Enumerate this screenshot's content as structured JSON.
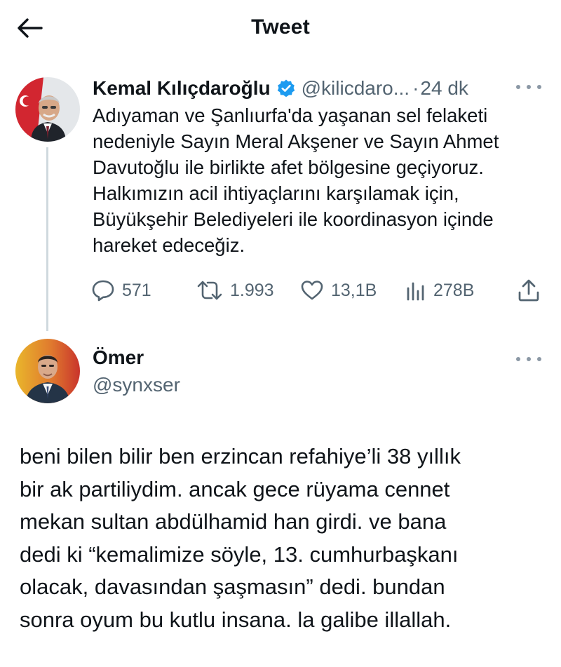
{
  "header": {
    "title": "Tweet",
    "back_icon": "arrow-left-icon"
  },
  "tweet": {
    "author_name": "Kemal Kılıçdaroğlu",
    "verified_icon": "verified-badge-icon",
    "verified_color": "#1d9bf0",
    "handle": "@kilicdaro...",
    "separator": "·",
    "time": "24 dk",
    "text_lines": [
      "Adıyaman ve Şanlıurfa'da yaşanan sel felaketi",
      "nedeniyle Sayın Meral Akşener ve Sayın Ahmet",
      "Davutoğlu ile birlikte afet bölgesine geçiyoruz.",
      "Halkımızın acil ihtiyaçlarını karşılamak için,",
      "Büyükşehir Belediyeleri ile koordinasyon içinde",
      "hareket edeceğiz."
    ],
    "actions": {
      "reply": {
        "icon": "reply-icon",
        "count": "571"
      },
      "retweet": {
        "icon": "retweet-icon",
        "count": "1.993"
      },
      "like": {
        "icon": "heart-icon",
        "count": "13,1B"
      },
      "views": {
        "icon": "views-chart-icon",
        "count": "278B"
      },
      "share": {
        "icon": "share-icon"
      }
    }
  },
  "reply": {
    "author_name": "Ömer",
    "handle": "@synxser",
    "text_lines": [
      "beni bilen bilir ben erzincan refahiye’li 38 yıllık",
      "bir ak partiliydim. ancak gece rüyama cennet",
      "mekan sultan abdülhamid han girdi. ve bana",
      "dedi ki “kemalimize söyle, 13. cumhurbaşkanı",
      "olacak, davasından şaşmasın” dedi. bundan",
      "sonra oyum bu kutlu insana. la galibe illallah."
    ]
  },
  "colors": {
    "text_primary": "#0f1419",
    "text_secondary": "#536471",
    "thread_line": "#cfd9de",
    "icon_gray": "#536471"
  }
}
